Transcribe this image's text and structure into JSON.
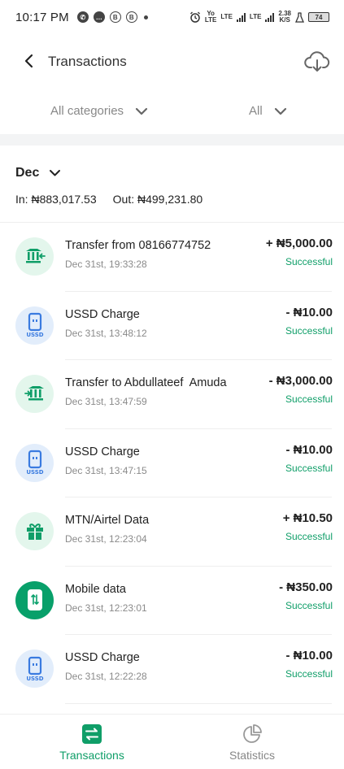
{
  "status_bar": {
    "time": "10:17 PM",
    "net_speed_top": "2.38",
    "net_speed_unit": "K/S",
    "battery": "74",
    "lte1": "LTE",
    "lte2": "LTE",
    "volte_top": "Yo",
    "volte_bottom": "LTE"
  },
  "header": {
    "title": "Transactions"
  },
  "filters": {
    "category": "All categories",
    "status": "All"
  },
  "summary": {
    "month": "Dec",
    "in": "In: ₦883,017.53",
    "out": "Out: ₦499,231.80"
  },
  "transactions": [
    {
      "icon": "bank-in-icon",
      "name": "Transfer from 08166774752",
      "date": "Dec 31st, 19:33:28",
      "amount": "+ ₦5,000.00",
      "status": "Successful"
    },
    {
      "icon": "ussd-icon",
      "name": "USSD Charge",
      "date": "Dec 31st, 13:48:12",
      "amount": "- ₦10.00",
      "status": "Successful"
    },
    {
      "icon": "bank-out-icon",
      "name": "Transfer to Abdullateef  Amuda",
      "date": "Dec 31st, 13:47:59",
      "amount": "- ₦3,000.00",
      "status": "Successful"
    },
    {
      "icon": "ussd-icon",
      "name": "USSD Charge",
      "date": "Dec 31st, 13:47:15",
      "amount": "- ₦10.00",
      "status": "Successful"
    },
    {
      "icon": "gift-icon",
      "name": "MTN/Airtel Data",
      "date": "Dec 31st, 12:23:04",
      "amount": "+ ₦10.50",
      "status": "Successful"
    },
    {
      "icon": "mobile-data-icon",
      "name": "Mobile data",
      "date": "Dec 31st, 12:23:01",
      "amount": "- ₦350.00",
      "status": "Successful"
    },
    {
      "icon": "ussd-icon",
      "name": "USSD Charge",
      "date": "Dec 31st, 12:22:28",
      "amount": "- ₦10.00",
      "status": "Successful"
    }
  ],
  "bottom_nav": {
    "transactions": "Transactions",
    "statistics": "Statistics"
  },
  "colors": {
    "accent": "#0f9e68",
    "ussd_blue": "#3a7be0"
  }
}
